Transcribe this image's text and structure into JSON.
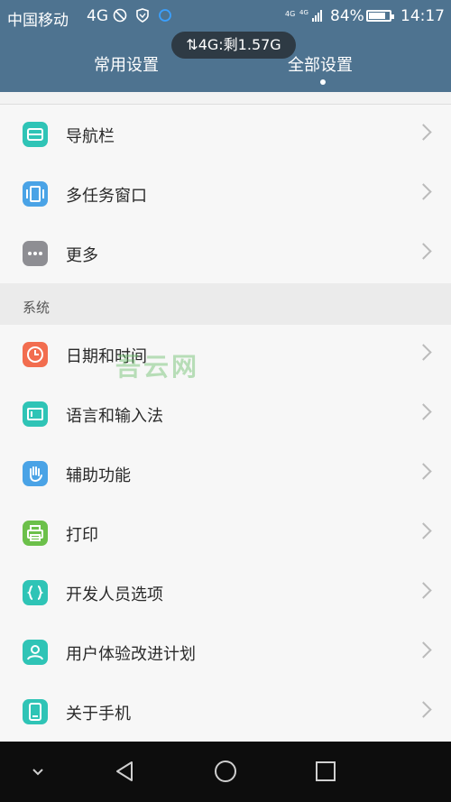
{
  "status_bar": {
    "carrier": "中国移动",
    "network": "4G",
    "battery_percent": "84%",
    "battery_level": 0.84,
    "time": "14:17"
  },
  "data_pill": "⇅4G:剩1.57G",
  "tabs": {
    "common": "常用设置",
    "all": "全部设置"
  },
  "list_top": [
    {
      "label": "导航栏",
      "icon": "navigation-bar-icon",
      "color": "#2fc4b6"
    },
    {
      "label": "多任务窗口",
      "icon": "multi-window-icon",
      "color": "#4aa3e6"
    },
    {
      "label": "更多",
      "icon": "more-icon",
      "color": "#8e8e93"
    }
  ],
  "section_title": "系统",
  "list_system": [
    {
      "label": "日期和时间",
      "icon": "clock-icon",
      "color": "#f26d4f"
    },
    {
      "label": "语言和输入法",
      "icon": "keyboard-icon",
      "color": "#2fc4b6"
    },
    {
      "label": "辅助功能",
      "icon": "hand-icon",
      "color": "#4aa3e6"
    },
    {
      "label": "打印",
      "icon": "printer-icon",
      "color": "#6cc04a"
    },
    {
      "label": "开发人员选项",
      "icon": "braces-icon",
      "color": "#2fc4b6"
    },
    {
      "label": "用户体验改进计划",
      "icon": "user-icon",
      "color": "#2fc4b6"
    },
    {
      "label": "关于手机",
      "icon": "phone-icon",
      "color": "#2fc4b6"
    }
  ],
  "watermark": "吾云网"
}
